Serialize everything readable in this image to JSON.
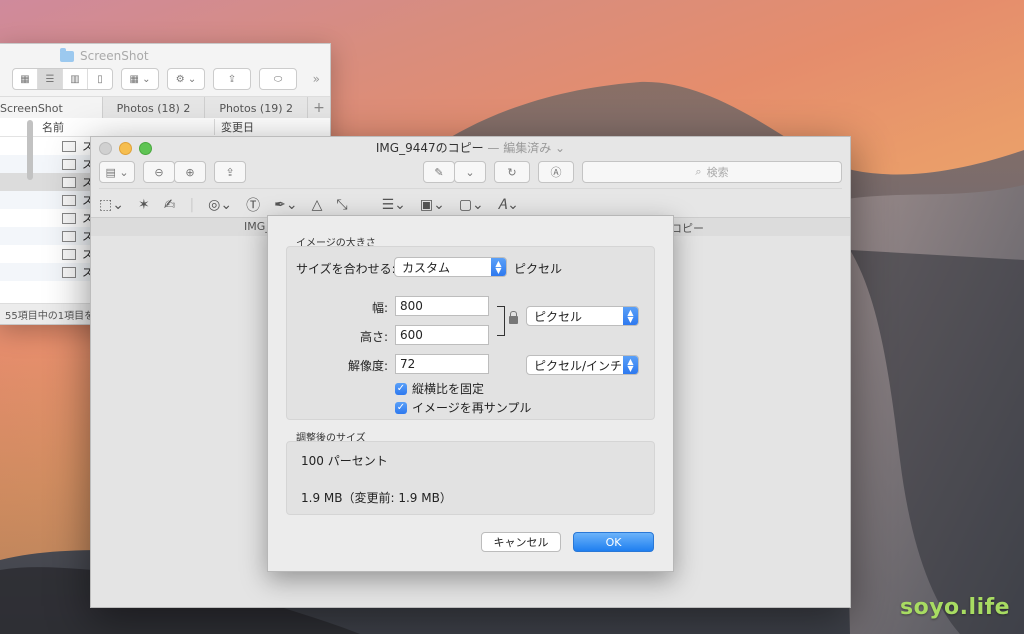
{
  "finder": {
    "title": "ScreenShot",
    "tabs": [
      "ScreenShot",
      "Photos (18) 2",
      "Photos (19) 2"
    ],
    "add_tab": "+",
    "columns": {
      "name": "名前",
      "date": "変更日"
    },
    "row_prefix": "ス",
    "status": "55項目中の1項目を"
  },
  "preview": {
    "title": "IMG_9447のコピー",
    "edited": " — 編集済み ⌄",
    "search_placeholder": "検索",
    "tab_left": "IMG_",
    "tab_right": "コピー"
  },
  "dialog": {
    "image_size_group": "イメージの大きさ",
    "fit_label": "サイズを合わせる:",
    "fit_value": "カスタム",
    "fit_unit": "ピクセル",
    "width_label": "幅:",
    "width_value": "800",
    "height_label": "高さ:",
    "height_value": "600",
    "dim_unit": "ピクセル",
    "resolution_label": "解像度:",
    "resolution_value": "72",
    "resolution_unit": "ピクセル/インチ",
    "keep_aspect": "縦横比を固定",
    "resample": "イメージを再サンプル",
    "result_group": "調整後のサイズ",
    "percent": "100 パーセント",
    "filesize": "1.9 MB（変更前: 1.9 MB）",
    "cancel": "キャンセル",
    "ok": "OK"
  },
  "watermark": "soyo.life"
}
